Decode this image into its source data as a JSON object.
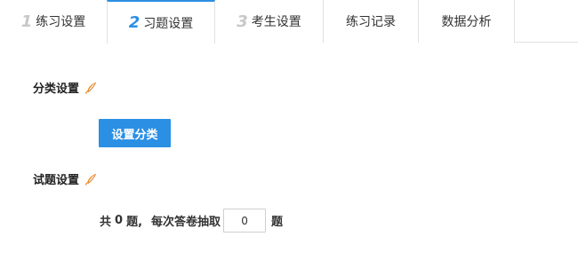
{
  "tabs": [
    {
      "num": "1",
      "label": "练习设置"
    },
    {
      "num": "2",
      "label": "习题设置"
    },
    {
      "num": "3",
      "label": "考生设置"
    },
    {
      "num": "",
      "label": "练习记录"
    },
    {
      "num": "",
      "label": "数据分析"
    }
  ],
  "active_tab": 1,
  "accent_color": "#2b8fe3",
  "edit_icon": "feather-pen-icon",
  "category_section": {
    "title": "分类设置",
    "button_label": "设置分类"
  },
  "question_section": {
    "title": "试题设置",
    "total_prefix": "共",
    "total_count": "0",
    "total_suffix": "题,",
    "draw_prefix": "每次答卷抽取",
    "draw_value": "0",
    "draw_suffix": "题"
  }
}
